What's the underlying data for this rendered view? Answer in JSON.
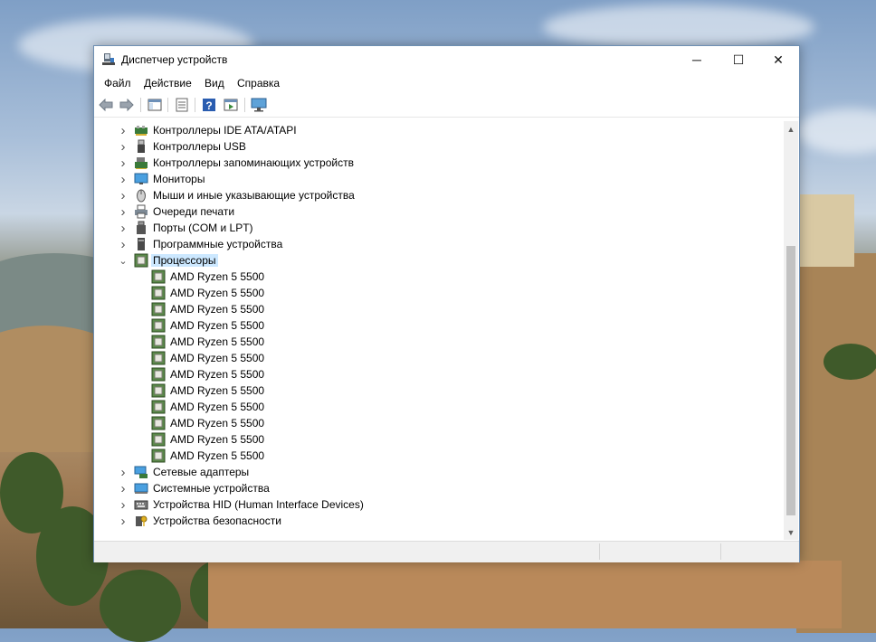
{
  "window": {
    "title": "Диспетчер устройств"
  },
  "window_controls": {
    "minimize": "─",
    "maximize": "☐",
    "close": "✕"
  },
  "menu": [
    "Файл",
    "Действие",
    "Вид",
    "Справка"
  ],
  "toolbar_icons": [
    "back-arrow-icon",
    "forward-arrow-icon",
    "show-hide-console-tree-icon",
    "properties-icon",
    "help-icon",
    "run-action-icon",
    "monitor-scan-icon"
  ],
  "tree": [
    {
      "label": "Контроллеры IDE ATA/ATAPI",
      "icon": "ide-controller-icon",
      "expanded": false
    },
    {
      "label": "Контроллеры USB",
      "icon": "usb-icon",
      "expanded": false
    },
    {
      "label": "Контроллеры запоминающих устройств",
      "icon": "storage-controller-icon",
      "expanded": false
    },
    {
      "label": "Мониторы",
      "icon": "monitor-icon",
      "expanded": false
    },
    {
      "label": "Мыши и иные указывающие устройства",
      "icon": "mouse-icon",
      "expanded": false
    },
    {
      "label": "Очереди печати",
      "icon": "printer-icon",
      "expanded": false
    },
    {
      "label": "Порты (COM и LPT)",
      "icon": "port-icon",
      "expanded": false
    },
    {
      "label": "Программные устройства",
      "icon": "software-device-icon",
      "expanded": false
    },
    {
      "label": "Процессоры",
      "icon": "processor-icon",
      "expanded": true,
      "selected": true,
      "children": [
        "AMD Ryzen 5 5500",
        "AMD Ryzen 5 5500",
        "AMD Ryzen 5 5500",
        "AMD Ryzen 5 5500",
        "AMD Ryzen 5 5500",
        "AMD Ryzen 5 5500",
        "AMD Ryzen 5 5500",
        "AMD Ryzen 5 5500",
        "AMD Ryzen 5 5500",
        "AMD Ryzen 5 5500",
        "AMD Ryzen 5 5500",
        "AMD Ryzen 5 5500"
      ]
    },
    {
      "label": "Сетевые адаптеры",
      "icon": "network-adapter-icon",
      "expanded": false
    },
    {
      "label": "Системные устройства",
      "icon": "system-device-icon",
      "expanded": false
    },
    {
      "label": "Устройства HID (Human Interface Devices)",
      "icon": "hid-icon",
      "expanded": false
    },
    {
      "label": "Устройства безопасности",
      "icon": "security-device-icon",
      "expanded": false
    }
  ],
  "colors": {
    "selection": "#cce8ff",
    "window_border": "#6e8fb3",
    "scroll_thumb": "#c2c2c2"
  }
}
